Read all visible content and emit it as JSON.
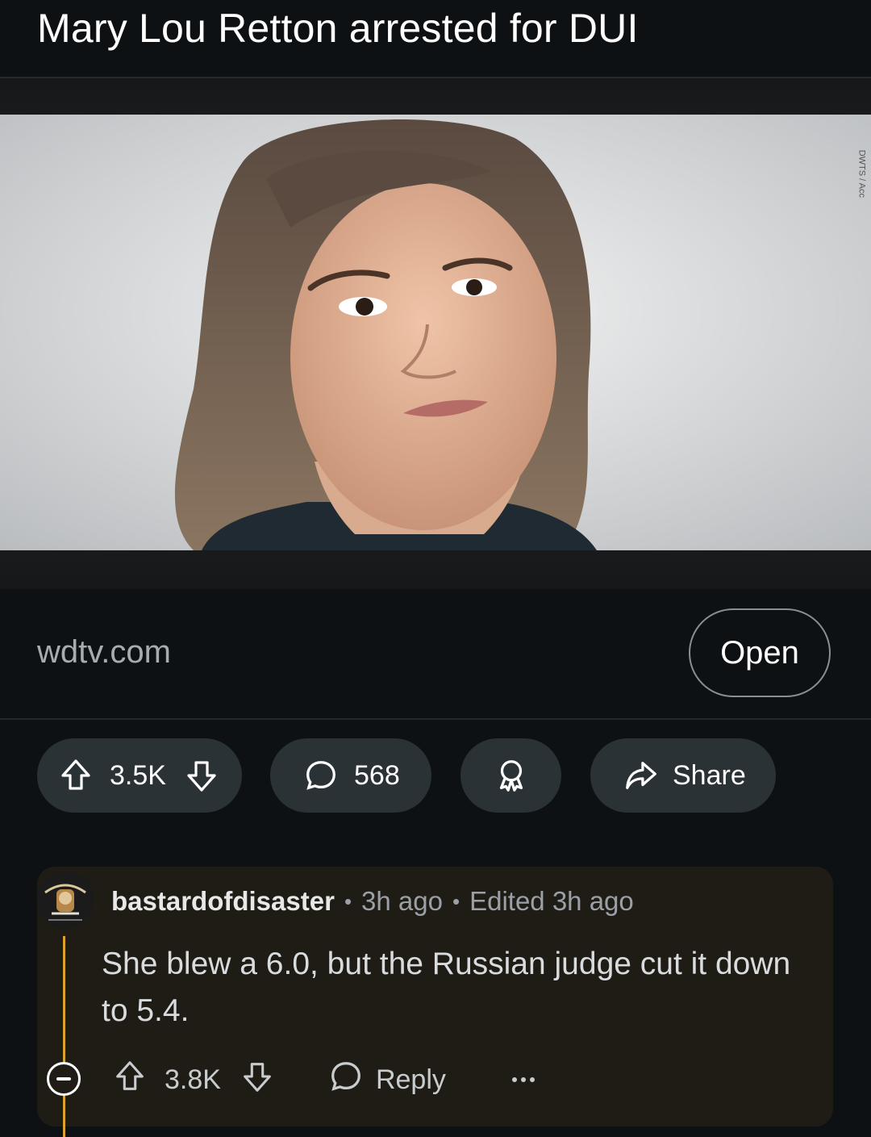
{
  "post": {
    "title": "Mary Lou Retton arrested for DUI",
    "image_credit": "DWTS / Acc",
    "link_domain": "wdtv.com",
    "open_label": "Open",
    "score": "3.5K",
    "comments_count": "568",
    "share_label": "Share"
  },
  "comment": {
    "username": "bastardofdisaster",
    "time": "3h ago",
    "edited": "Edited 3h ago",
    "body": "She blew a 6.0, but the Russian judge cut it down to 5.4.",
    "score": "3.8K",
    "reply_label": "Reply",
    "thread_color": "#d8a52a"
  },
  "icons": [
    "upvote-icon",
    "downvote-icon",
    "comment-icon",
    "award-icon",
    "share-icon",
    "collapse-icon",
    "more-icon",
    "reply-icon"
  ]
}
